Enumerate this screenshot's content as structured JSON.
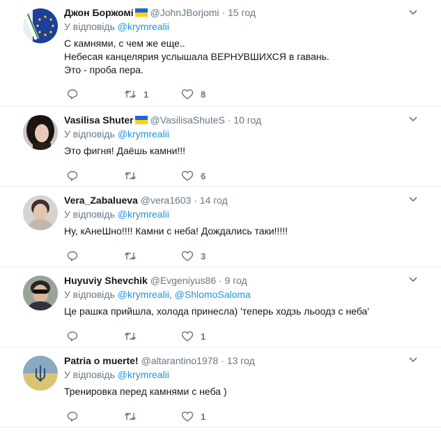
{
  "tweets": [
    {
      "name": "Джон Боржомі",
      "handle": "@JohnJBorjomi",
      "time": "15 год",
      "reply_prefix": "У відповідь",
      "mentions": [
        "@krymrealii"
      ],
      "lines": [
        "С камнями, с чем же еще..",
        "Небесая канцелярия услышала ВЕРНУВШИХСЯ в гавань.",
        "Это - проба пера."
      ],
      "retweets": "1",
      "likes": "8",
      "avatar": "eu-flag-logo-avatar"
    },
    {
      "name": "Vasilisa Shuter",
      "handle": "@VasilisaShuteS",
      "time": "10 год",
      "reply_prefix": "У відповідь",
      "mentions": [
        "@krymrealii"
      ],
      "lines": [
        "Это фигня! Даёшь камни!!!"
      ],
      "retweets": "",
      "likes": "6",
      "avatar": "woman-portrait-avatar"
    },
    {
      "name": "Vera_Zabalueva",
      "handle": "@vera1603",
      "time": "14 год",
      "reply_prefix": "У відповідь",
      "mentions": [
        "@krymrealii"
      ],
      "lines": [
        "Ну, кАнеШно!!!! Камни с неба! Дождались таки!!!!!"
      ],
      "retweets": "",
      "likes": "3",
      "avatar": "man-portrait-avatar"
    },
    {
      "name": "Huyuviy Shevchik",
      "handle": "@Evgeniyus86",
      "time": "9 год",
      "reply_prefix": "У відповідь",
      "mentions": [
        "@krymrealii",
        "@ShlomoSaloma"
      ],
      "lines": [
        "Це рашка прийшла, холода принесла) 'теперь ходзь льоодз с неба'"
      ],
      "retweets": "",
      "likes": "1",
      "avatar": "sunglasses-portrait-avatar"
    },
    {
      "name": "Patria o muerte!",
      "handle": "@altarantino1978",
      "time": "13 год",
      "reply_prefix": "У відповідь",
      "mentions": [
        "@krymrealii"
      ],
      "lines": [
        "Тренировка перед камнями с неба )"
      ],
      "retweets": "",
      "likes": "1",
      "avatar": "ukraine-trident-flag-avatar"
    }
  ],
  "colors": {
    "link": "#1b95e0",
    "muted": "#657786",
    "text": "#14171a",
    "divider": "#e6ecf0"
  }
}
